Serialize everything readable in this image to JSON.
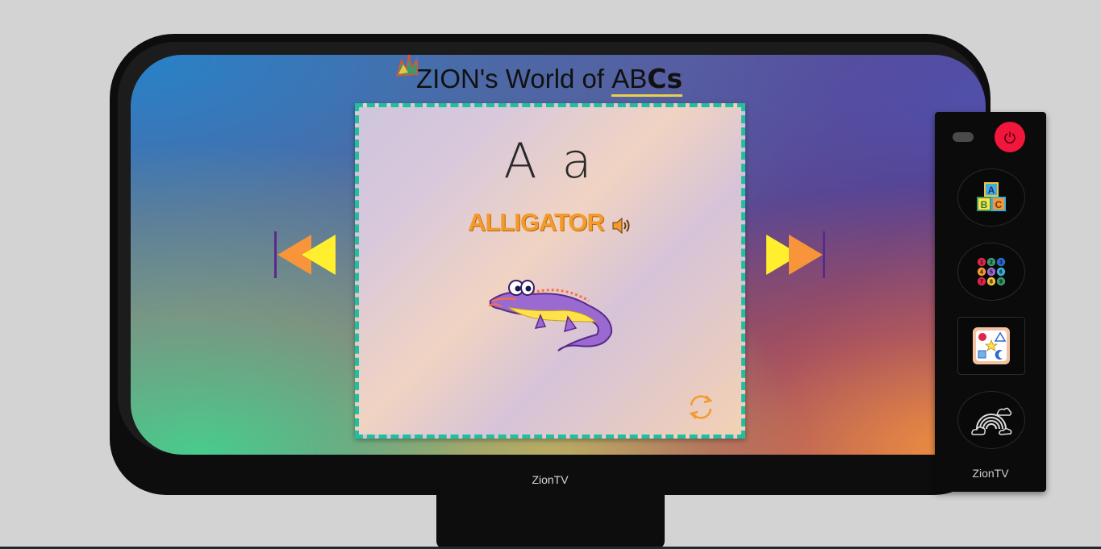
{
  "title": {
    "prefix": "ZION's World of ",
    "abc": "AB",
    "cs": "Cs"
  },
  "card": {
    "letter": "A a",
    "word": "ALLIGATOR",
    "image_icon": "alligator-illustration",
    "audio_icon": "speaker-icon",
    "flip_icon": "refresh-icon"
  },
  "navigation": {
    "prev_icon": "rewind-icon",
    "next_icon": "fast-forward-icon"
  },
  "tv": {
    "brand": "ZionTV"
  },
  "remote": {
    "power_icon": "power-icon",
    "buttons": [
      {
        "icon": "abc-blocks-icon",
        "name": "alphabet"
      },
      {
        "icon": "numbers-icon",
        "name": "numbers"
      },
      {
        "icon": "shapes-icon",
        "name": "shapes"
      },
      {
        "icon": "rainbow-icon",
        "name": "colors"
      }
    ],
    "number_digits": [
      "1",
      "2",
      "3",
      "4",
      "5",
      "6",
      "7",
      "8",
      "9"
    ],
    "brand": "ZionTV"
  },
  "colors": {
    "accent_orange": "#f39a2c",
    "arrow_yellow": "#ffef2e",
    "card_border": "#1fbfa0",
    "power_red": "#f2163c"
  }
}
